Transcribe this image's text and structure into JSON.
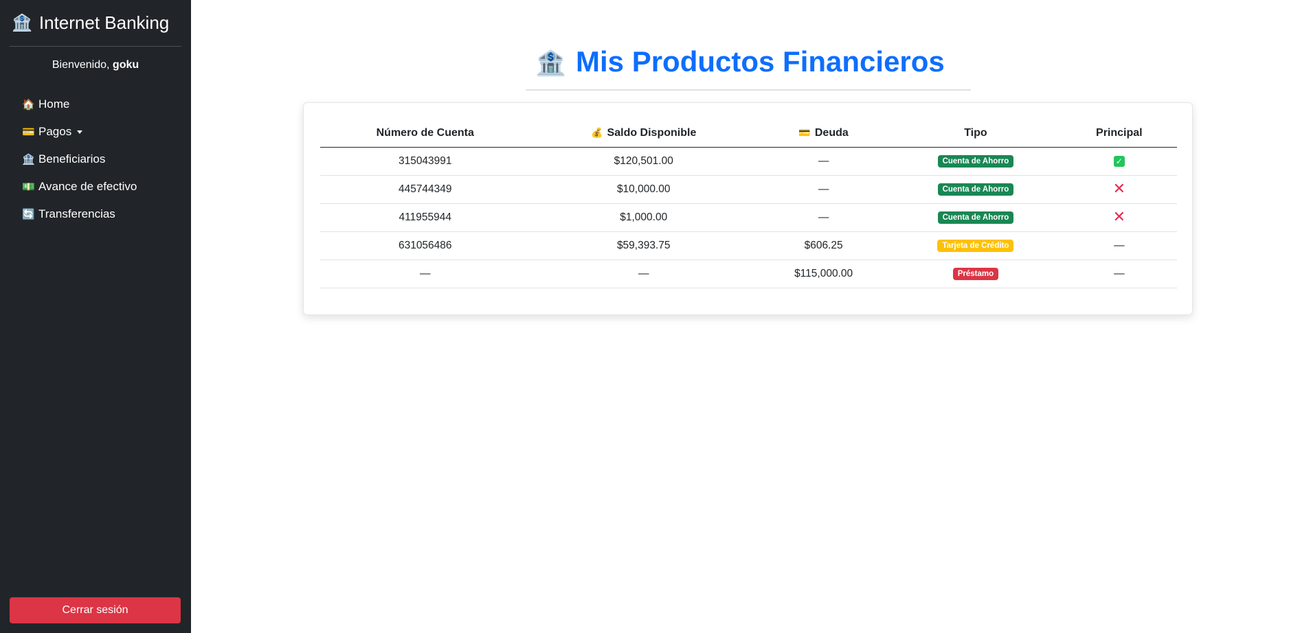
{
  "sidebar": {
    "brand_icon": "🏦",
    "brand": "Internet Banking",
    "welcome_prefix": "Bienvenido, ",
    "username": "goku",
    "items": [
      {
        "icon": "🏠",
        "icon_name": "home-icon",
        "label": "Home"
      },
      {
        "icon": "💳",
        "icon_name": "credit-card-icon",
        "label": "Pagos",
        "dropdown": true
      },
      {
        "icon": "🏦",
        "icon_name": "bank-icon",
        "label": "Beneficiarios"
      },
      {
        "icon": "💵",
        "icon_name": "cash-icon",
        "label": "Avance de efectivo"
      },
      {
        "icon": "🔄",
        "icon_name": "transfer-icon",
        "label": "Transferencias"
      }
    ],
    "logout_label": "Cerrar sesión"
  },
  "main": {
    "title_icon": "🏦",
    "title": "Mis Productos Financieros",
    "table": {
      "headers": [
        {
          "label": "Número de Cuenta",
          "icon": ""
        },
        {
          "label": "Saldo Disponible",
          "icon": "💰"
        },
        {
          "label": "Deuda",
          "icon": "💳"
        },
        {
          "label": "Tipo",
          "icon": ""
        },
        {
          "label": "Principal",
          "icon": ""
        }
      ],
      "rows": [
        {
          "account": "315043991",
          "balance": "$120,501.00",
          "debt": "—",
          "type": "Cuenta de Ahorro",
          "type_style": "ahorro",
          "principal": "check"
        },
        {
          "account": "445744349",
          "balance": "$10,000.00",
          "debt": "—",
          "type": "Cuenta de Ahorro",
          "type_style": "ahorro",
          "principal": "x"
        },
        {
          "account": "411955944",
          "balance": "$1,000.00",
          "debt": "—",
          "type": "Cuenta de Ahorro",
          "type_style": "ahorro",
          "principal": "x"
        },
        {
          "account": "631056486",
          "balance": "$59,393.75",
          "debt": "$606.25",
          "type": "Tarjeta de Crédito",
          "type_style": "credito",
          "principal": "—"
        },
        {
          "account": "—",
          "balance": "—",
          "debt": "$115,000.00",
          "type": "Préstamo",
          "type_style": "prestamo",
          "principal": "—"
        }
      ]
    }
  },
  "colors": {
    "sidebar_bg": "#212529",
    "title": "#0d6efd",
    "logout": "#dc3545",
    "badge_ahorro": "#198754",
    "badge_credito": "#ffc107",
    "badge_prestamo": "#dc3545",
    "check": "#22c55e",
    "x": "#e8294f"
  }
}
